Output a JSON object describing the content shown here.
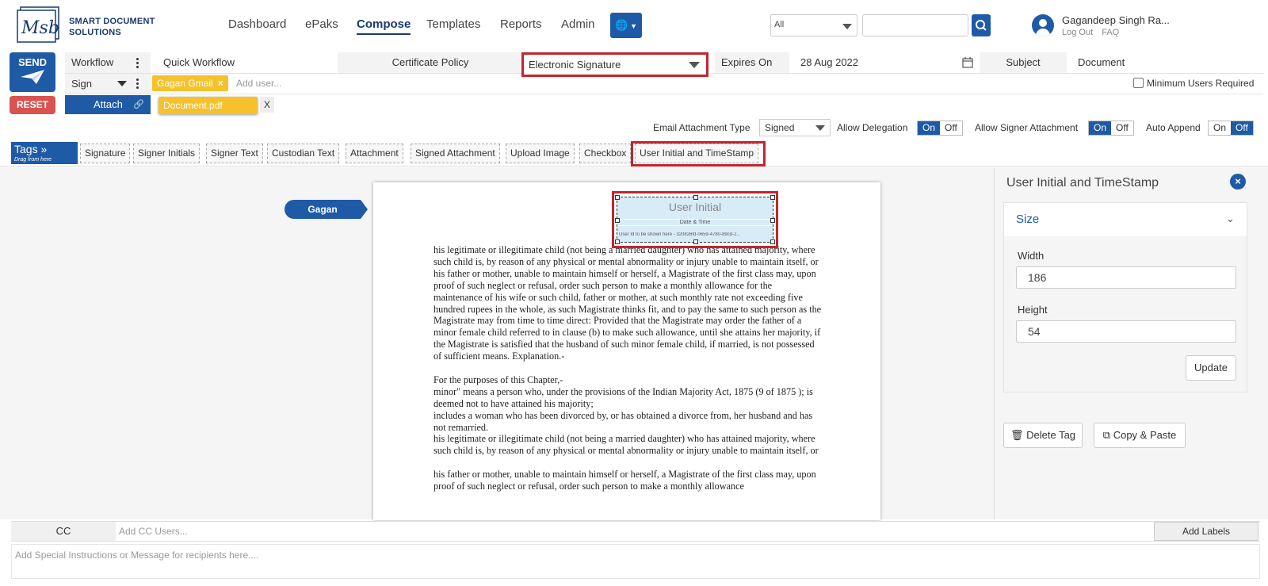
{
  "brand": {
    "line1": "SMART DOCUMENT",
    "line2": "SOLUTIONS"
  },
  "nav": [
    {
      "label": "Dashboard"
    },
    {
      "label": "ePaks"
    },
    {
      "label": "Compose"
    },
    {
      "label": "Templates"
    },
    {
      "label": "Reports"
    },
    {
      "label": "Admin"
    }
  ],
  "search": {
    "scope": "All",
    "query": ""
  },
  "user": {
    "name": "Gagandeep Singh Ra...",
    "logout": "Log Out",
    "faq": "FAQ"
  },
  "actions": {
    "send": "SEND",
    "reset": "RESET"
  },
  "form": {
    "workflow_label": "Workflow",
    "workflow_value": "Quick Workflow",
    "cert_policy_label": "Certificate Policy",
    "cert_policy_value": "Electronic Signature",
    "expires_label": "Expires On",
    "expires_value": "28 Aug 2022",
    "subject_label": "Subject",
    "subject_value": "Document",
    "sign_label": "Sign",
    "signer_chip": "Gagan Gmail",
    "add_user_placeholder": "Add user...",
    "min_users_label": "Minimum Users Required",
    "attach_label": "Attach",
    "attachment_chip": "Document.pdf",
    "remove_x": "X"
  },
  "options": {
    "email_attachment_type_label": "Email Attachment Type",
    "email_attachment_type_value": "Signed",
    "allow_delegation_label": "Allow Delegation",
    "allow_signer_attachment_label": "Allow Signer Attachment",
    "auto_append_label": "Auto Append",
    "on": "On",
    "off": "Off"
  },
  "tags": {
    "label": "Tags",
    "hint": "Drag from here",
    "items": [
      "Signature",
      "Signer Initials",
      "Signer Text",
      "Custodian Text",
      "Attachment",
      "Signed Attachment",
      "Upload Image",
      "Checkbox",
      "User Initial and TimeStamp"
    ]
  },
  "document": {
    "signer_tag": "Gagan",
    "placed_tag": {
      "title": "User Initial",
      "subtitle": "Date & Time",
      "footer": "User Id to be shown here - 320826fd-0659-4780-89cd-2..."
    },
    "paragraphs": [
      "his legitimate or illegitimate child (not being a married daughter) who has attained majority, where such child is, by reason of any physical or mental abnormality or injury unable to maintain itself, or",
      "his father or mother, unable to maintain himself or herself, a Magistrate of the first class may, upon proof of such neglect or refusal, order such person to make a monthly allowance for the maintenance of his wife or such child, father or mother, at such monthly rate not exceeding five hundred rupees in the whole, as such Magistrate thinks fit, and to pay the same to such person as the Magistrate may from time to time direct: Provided that the Magistrate may order the father of a minor female child referred to in clause (b) to make such allowance, until she attains her majority, if the Magistrate is satisfied that the husband of such minor female child, if married, is not possessed of sufficient means. Explanation.-",
      "",
      "For the purposes of this Chapter,-",
      "minor\" means a person who, under the provisions of the Indian Majority Act, 1875 (9 of 1875 ); is deemed not to have attained his majority;",
      "includes a woman who has been divorced by, or has obtained a divorce from, her husband and has not remarried.",
      "his legitimate or illegitimate child (not being a married daughter) who has attained majority, where such child is, by reason of any physical or mental abnormality or injury unable to maintain itself, or",
      "",
      "his father or mother, unable to maintain himself or herself, a Magistrate of the first class may, upon proof of such neglect or refusal, order such person to make a monthly allowance"
    ]
  },
  "panel": {
    "title": "User Initial and TimeStamp",
    "section": "Size",
    "width_label": "Width",
    "width_value": "186",
    "height_label": "Height",
    "height_value": "54",
    "update": "Update",
    "delete_tag": "Delete Tag",
    "copy_paste": "Copy & Paste"
  },
  "bottom": {
    "cc_label": "CC",
    "cc_placeholder": "Add CC Users...",
    "add_labels": "Add Labels",
    "message_placeholder": "Add Special Instructions or Message for recipients here...."
  },
  "colors": {
    "primary": "#1f5aa6",
    "highlight": "#c2262e",
    "chip": "#f5c12c",
    "reset": "#d9534f"
  }
}
